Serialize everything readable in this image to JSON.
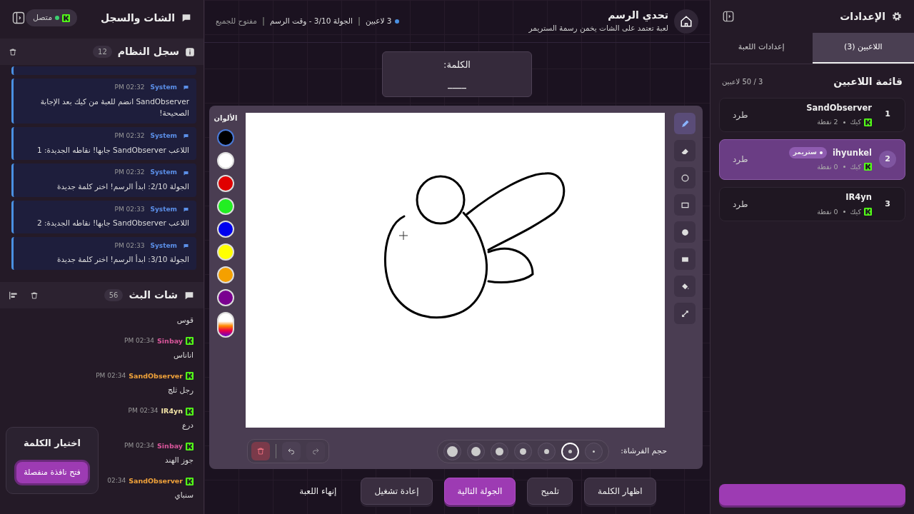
{
  "chat_panel": {
    "title": "الشات والسجل",
    "connection": {
      "label": "متصل",
      "connected": true
    }
  },
  "system_log": {
    "title": "سجل النظام",
    "count": "12",
    "messages": [
      {
        "sender": "System",
        "time": "02:32 PM",
        "text": "SandObserver انضم للعبة من كيك بعد الإجابة الصحيحة!"
      },
      {
        "sender": "System",
        "time": "02:32 PM",
        "text": "اللاعب SandObserver جابها! نقاطه الجديدة: 1"
      },
      {
        "sender": "System",
        "time": "02:32 PM",
        "text": "الجولة 2/10: ابدأ الرسم! اختر كلمة جديدة"
      },
      {
        "sender": "System",
        "time": "02:33 PM",
        "text": "اللاعب SandObserver جابها! نقاطه الجديدة: 2"
      },
      {
        "sender": "System",
        "time": "02:33 PM",
        "text": "الجولة 3/10: ابدأ الرسم! اختر كلمة جديدة"
      }
    ]
  },
  "stream_chat": {
    "title": "شات البث",
    "count": "56",
    "messages": [
      {
        "text": "قوس"
      },
      {
        "user": "Sinbay",
        "color": "#d9569b",
        "time": "02:34 PM",
        "text": "اناناس"
      },
      {
        "user": "SandObserver",
        "color": "#f0a23a",
        "time": "02:34 PM",
        "text": "رجل ثلج"
      },
      {
        "user": "IR4yn",
        "color": "#f2e3a6",
        "time": "02:34 PM",
        "text": "درع"
      },
      {
        "user": "Sinbay",
        "color": "#d9569b",
        "time": "02:34 PM",
        "text": "جوز الهند"
      },
      {
        "user": "SandObserver",
        "color": "#f0a23a",
        "time": "02:34",
        "text": "سنباي"
      }
    ]
  },
  "word_popup": {
    "title": "اختيار الكلمة",
    "button": "فتح نافذة منفصلة"
  },
  "header": {
    "title": "تحدي الرسم",
    "subtitle": "لعبة تعتمد على الشات يخمن رسمة الستريمر",
    "meta": [
      "3 لاعبين",
      "الجولة 3/10 - وقت الرسم",
      "مفتوح للجميع"
    ]
  },
  "word_box": {
    "label": "الكلمة:",
    "word": "____"
  },
  "palette": {
    "title": "الألوان",
    "colors": [
      {
        "color": "#000000",
        "selected": true
      },
      {
        "color": "#ffffff",
        "selected": false
      },
      {
        "color": "#e00000",
        "selected": false
      },
      {
        "color": "#22ee22",
        "selected": false
      },
      {
        "color": "#0000ee",
        "selected": false
      },
      {
        "color": "#ffff00",
        "selected": false
      },
      {
        "color": "#f5a000",
        "selected": false
      },
      {
        "color": "#7a0090",
        "selected": false
      }
    ]
  },
  "tools": [
    {
      "kind": "pen",
      "selected": true
    },
    {
      "kind": "eraser",
      "selected": false
    },
    {
      "kind": "circle",
      "selected": false
    },
    {
      "kind": "rectangle",
      "selected": false
    },
    {
      "kind": "filled-circle",
      "selected": false
    },
    {
      "kind": "filled-rectangle",
      "selected": false
    },
    {
      "kind": "fill",
      "selected": false
    },
    {
      "kind": "line",
      "selected": false
    }
  ],
  "brush": {
    "label": "حجم الفرشاة:",
    "sizes": [
      {
        "selected": false
      },
      {
        "selected": true
      },
      {
        "selected": false
      },
      {
        "selected": false
      },
      {
        "selected": false
      },
      {
        "selected": false
      },
      {
        "selected": false
      }
    ]
  },
  "actions": [
    {
      "kind": "default",
      "label": "اظهار الكلمة"
    },
    {
      "kind": "default",
      "label": "تلميح"
    },
    {
      "kind": "primary",
      "label": "الجولة التالية"
    },
    {
      "kind": "default",
      "label": "إعادة تشغيل"
    },
    {
      "kind": "link",
      "label": "إنهاء اللعبة"
    }
  ],
  "settings": {
    "title": "الإعدادات",
    "tabs": [
      {
        "label": "اللاعبين (3)",
        "selected": true
      },
      {
        "label": "إعدادات اللعبة",
        "selected": false
      }
    ],
    "list_title": "قائمة اللاعبين",
    "capacity": "3 / 50 لاعبين",
    "players": [
      {
        "rank": "1",
        "name": "SandObserver",
        "platform": "كيك",
        "points": "2 نقطة",
        "kick": "طرد",
        "selected": false
      },
      {
        "rank": "2",
        "name": "ihyunkel",
        "badge": "ستريمر",
        "platform": "كيك",
        "points": "0 نقطة",
        "kick": "طرد",
        "selected": true
      },
      {
        "rank": "3",
        "name": "IR4yn",
        "platform": "كيك",
        "points": "0 نقطة",
        "kick": "طرد",
        "selected": false
      }
    ]
  }
}
